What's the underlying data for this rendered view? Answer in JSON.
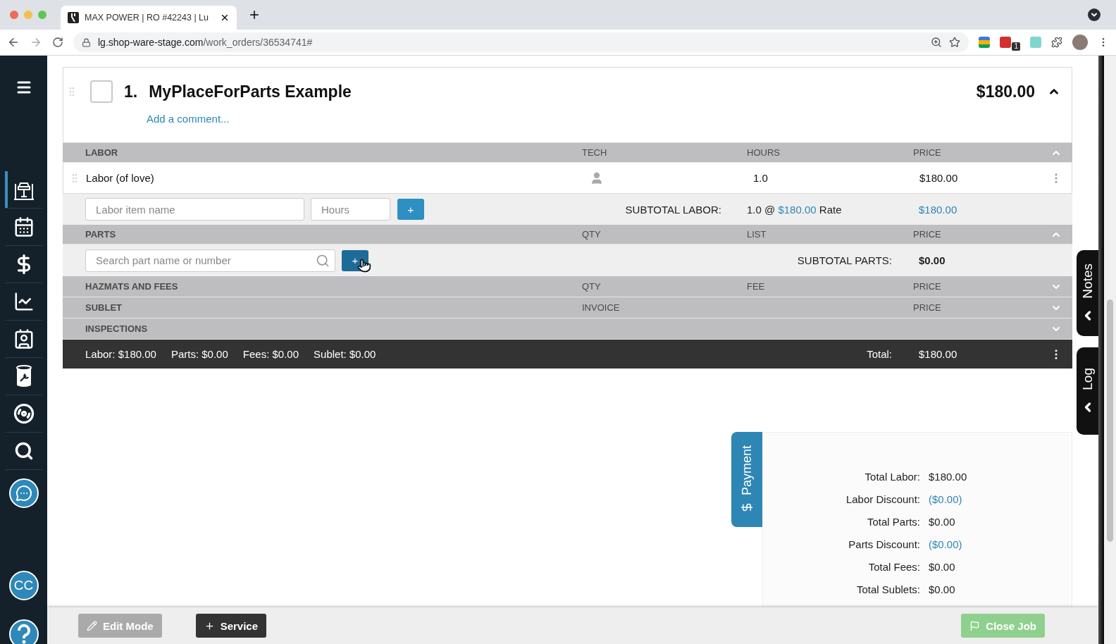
{
  "browser": {
    "tab_title": "MAX POWER | RO #42243 | Lu",
    "url_host": "lg.shop-ware-stage.com",
    "url_path": "/work_orders/36534741#",
    "extension_badge": "1"
  },
  "sidebar": {
    "items": [
      {
        "kind": "menu",
        "selected": false
      },
      {
        "kind": "lift",
        "selected": true
      },
      {
        "kind": "calendar",
        "selected": false
      },
      {
        "kind": "money",
        "selected": false
      },
      {
        "kind": "chart",
        "selected": false
      },
      {
        "kind": "contacts",
        "selected": false
      },
      {
        "kind": "oil",
        "selected": false
      },
      {
        "kind": "tire",
        "selected": false
      },
      {
        "kind": "search",
        "selected": false
      },
      {
        "kind": "chat",
        "selected": false
      }
    ],
    "avatar": "CC"
  },
  "service": {
    "number": "1.",
    "title": "MyPlaceForParts Example",
    "checked": false,
    "price": "$180.00",
    "expanded": true,
    "comment_link": "Add a comment..."
  },
  "sections": [
    {
      "kind": "labor",
      "title": "LABOR",
      "columns": [
        "TECH",
        "HOURS",
        "PRICE"
      ],
      "expanded": true
    },
    {
      "kind": "parts",
      "title": "PARTS",
      "columns": [
        "QTY",
        "LIST",
        "PRICE"
      ],
      "expanded": true
    },
    {
      "kind": "fees",
      "title": "HAZMATS AND FEES",
      "columns": [
        "QTY",
        "FEE",
        "PRICE"
      ],
      "expanded": false
    },
    {
      "kind": "sublet",
      "title": "SUBLET",
      "columns": [
        "INVOICE",
        null,
        "PRICE"
      ],
      "expanded": false
    },
    {
      "kind": "inspections",
      "title": "INSPECTIONS",
      "columns": [
        null,
        null,
        null
      ],
      "expanded": false
    }
  ],
  "labor": {
    "rows": [
      {
        "name": "Labor (of love)",
        "hours": "1.0",
        "price": "$180.00"
      }
    ],
    "name_placeholder": "Labor item name",
    "hours_placeholder": "Hours",
    "add_button": "+",
    "subtotal_label": "SUBTOTAL LABOR:",
    "subtotal_prefix": "1.0 @",
    "subtotal_rate": "$180.00",
    "subtotal_suffix": "Rate",
    "subtotal_value": "$180.00"
  },
  "parts": {
    "search_placeholder": "Search part name or number",
    "add_button": "+",
    "subtotal_label": "SUBTOTAL PARTS:",
    "subtotal_value": "$0.00"
  },
  "footer": {
    "items": [
      "Labor: $180.00",
      "Parts: $0.00",
      "Fees: $0.00",
      "Sublet: $0.00"
    ],
    "total_label": "Total:",
    "total_value": "$180.00"
  },
  "side_tabs": [
    "Notes",
    "Log"
  ],
  "payment": {
    "tab": "Payment",
    "rows": [
      {
        "label": "Total Labor:",
        "value": "$180.00",
        "kind": "plain"
      },
      {
        "label": "Labor Discount:",
        "value": "($0.00)",
        "kind": "link"
      },
      {
        "label": "Total Parts:",
        "value": "$0.00",
        "kind": "plain"
      },
      {
        "label": "Parts Discount:",
        "value": "($0.00)",
        "kind": "link"
      },
      {
        "label": "Total Fees:",
        "value": "$0.00",
        "kind": "plain"
      },
      {
        "label": "Total Sublets:",
        "value": "$0.00",
        "kind": "plain"
      }
    ]
  },
  "bottom_bar": {
    "buttons": [
      {
        "label": "Edit Mode",
        "kind": "edit",
        "disabled": true
      },
      {
        "label": "Service",
        "kind": "add",
        "disabled": false
      },
      {
        "label": "Close Job",
        "kind": "close",
        "disabled": true
      }
    ]
  }
}
